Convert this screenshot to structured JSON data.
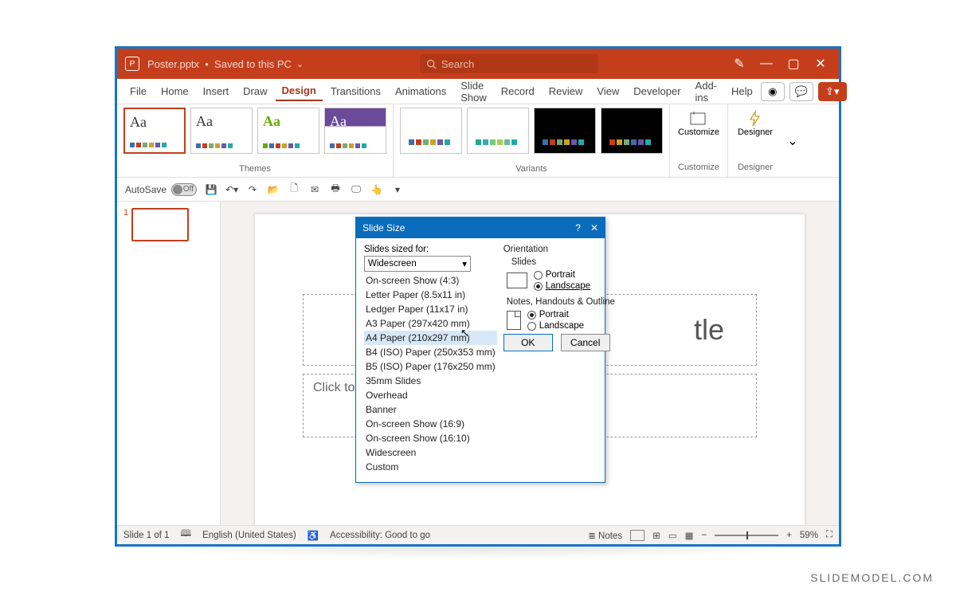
{
  "titlebar": {
    "filename": "Poster.pptx",
    "save_state": "Saved to this PC",
    "search_placeholder": "Search"
  },
  "menu": {
    "items": [
      "File",
      "Home",
      "Insert",
      "Draw",
      "Design",
      "Transitions",
      "Animations",
      "Slide Show",
      "Record",
      "Review",
      "View",
      "Developer",
      "Add-ins",
      "Help"
    ],
    "active": "Design"
  },
  "ribbon": {
    "themes_label": "Themes",
    "variants_label": "Variants",
    "customize_label": "Customize",
    "designer_btn": "Designer",
    "designer_label": "Designer"
  },
  "qat": {
    "autosave": "AutoSave",
    "off": "Off"
  },
  "thumb": {
    "number": "1"
  },
  "slide": {
    "title_ph": "tle",
    "sub_ph": "Click to add subtitle"
  },
  "dialog": {
    "title": "Slide Size",
    "sized_for_label": "Slides sized for:",
    "selected": "Widescreen",
    "options": [
      "On-screen Show (4:3)",
      "Letter Paper (8.5x11 in)",
      "Ledger Paper (11x17 in)",
      "A3 Paper (297x420 mm)",
      "A4 Paper (210x297 mm)",
      "B4 (ISO) Paper (250x353 mm)",
      "B5 (ISO) Paper (176x250 mm)",
      "35mm Slides",
      "Overhead",
      "Banner",
      "On-screen Show (16:9)",
      "On-screen Show (16:10)",
      "Widescreen",
      "Custom"
    ],
    "orientation_label": "Orientation",
    "slides_label": "Slides",
    "notes_label": "Notes, Handouts & Outline",
    "portrait": "Portrait",
    "landscape": "Landscape",
    "ok": "OK",
    "cancel": "Cancel"
  },
  "statusbar": {
    "slide_of": "Slide 1 of 1",
    "lang": "English (United States)",
    "accessibility": "Accessibility: Good to go",
    "notes": "Notes",
    "zoom": "59%"
  },
  "watermark": "SLIDEMODEL.COM"
}
